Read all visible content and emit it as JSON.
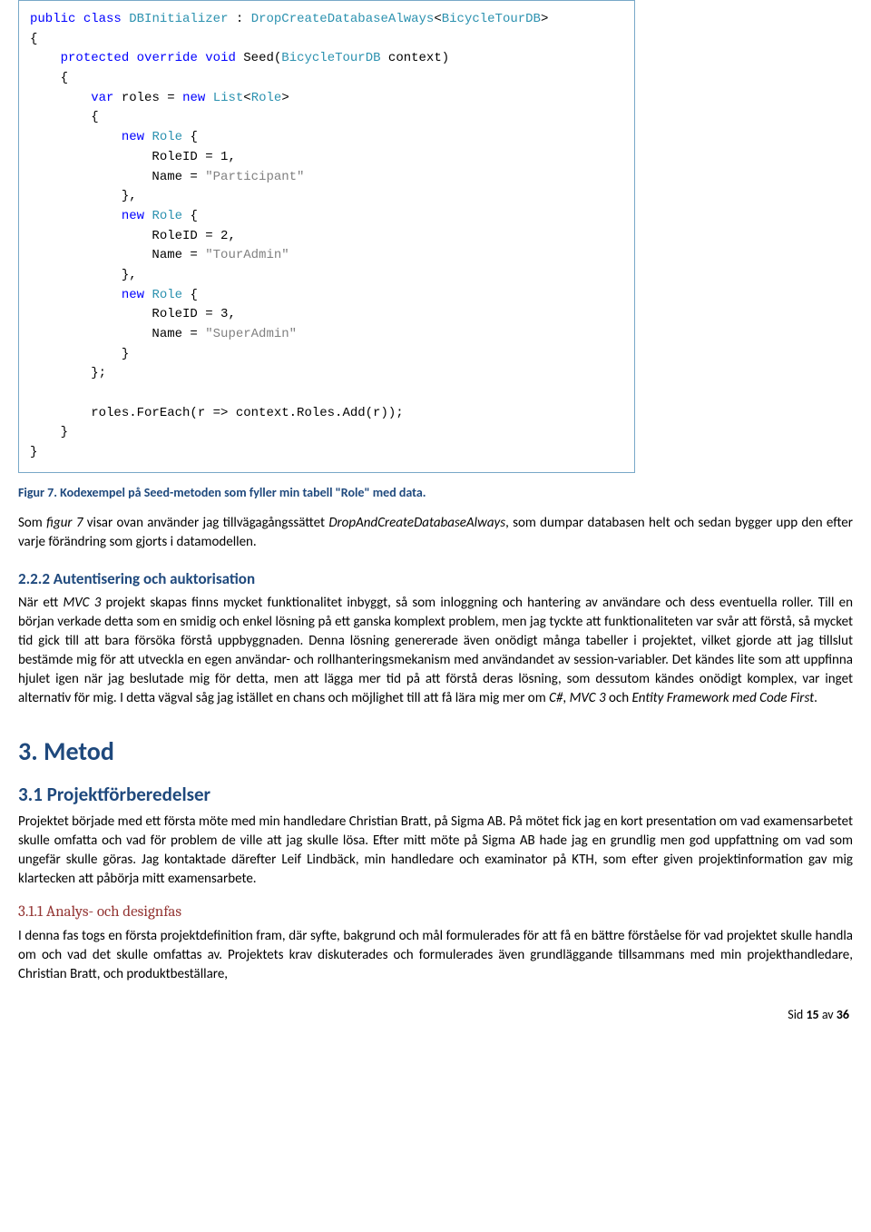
{
  "code": {
    "line1_kw1": "public",
    "line1_kw2": "class",
    "line1_type1": "DBInitializer",
    "line1_sep": " : ",
    "line1_type2": "DropCreateDatabaseAlways",
    "line1_lt": "<",
    "line1_type3": "BicycleTourDB",
    "line1_gt": ">",
    "line2": "{",
    "line3_kw1": "protected",
    "line3_kw2": "override",
    "line3_kw3": "void",
    "line3_name": " Seed(",
    "line3_type": "BicycleTourDB",
    "line3_rest": " context)",
    "line4": "    {",
    "line5_kw1": "var",
    "line5_txt1": " roles = ",
    "line5_kw2": "new",
    "line5_txt2": " ",
    "line5_type1": "List",
    "line5_lt": "<",
    "line5_type2": "Role",
    "line5_gt": ">",
    "line6": "        {",
    "line7_kw": "new",
    "line7_type": "Role",
    "line7_rest": " {",
    "line8_txt": "                RoleID = ",
    "line8_num": "1",
    "line8_comma": ",",
    "line9_txt": "                Name = ",
    "line9_str": "\"Participant\"",
    "line10": "            },",
    "line11_kw": "new",
    "line11_type": "Role",
    "line11_rest": " {",
    "line12_txt": "                RoleID = ",
    "line12_num": "2",
    "line12_comma": ",",
    "line13_txt": "                Name = ",
    "line13_str": "\"TourAdmin\"",
    "line14": "            },",
    "line15_kw": "new",
    "line15_type": "Role",
    "line15_rest": " {",
    "line16_txt": "                RoleID = ",
    "line16_num": "3",
    "line16_comma": ",",
    "line17_txt": "                Name = ",
    "line17_str": "\"SuperAdmin\"",
    "line18": "            }",
    "line19": "        };",
    "line20": "",
    "line21": "        roles.ForEach(r => context.Roles.Add(r));",
    "line22": "    }",
    "line23": "}"
  },
  "caption": "Figur 7. Kodexempel på Seed-metoden som fyller min tabell \"Role\" med data.",
  "para1_a": "Som ",
  "para1_b": "figur 7",
  "para1_c": " visar ovan använder jag tillvägagångssättet ",
  "para1_d": "DropAndCreateDatabaseAlways",
  "para1_e": ", som dumpar databasen helt och sedan bygger upp den efter varje förändring som gjorts i datamodellen.",
  "h4_1": "2.2.2 Autentisering och auktorisation",
  "para2_a": "När ett ",
  "para2_b": "MVC 3",
  "para2_c": " projekt skapas finns mycket funktionalitet inbyggt, så som inloggning och hantering av användare och dess eventuella roller. Till en början verkade detta som en smidig och enkel lösning på ett ganska komplext problem, men jag tyckte att funktionaliteten var svår att förstå, så mycket tid gick till att bara försöka förstå uppbyggnaden. Denna lösning genererade även onödigt många tabeller i projektet, vilket gjorde att jag tillslut bestämde mig för att utveckla en egen användar- och rollhanteringsmekanism med användandet av session-variabler. Det kändes lite som att uppfinna hjulet igen när jag beslutade mig för detta, men att lägga mer tid på att förstå deras lösning, som dessutom kändes onödigt komplex, var inget alternativ för mig. I detta vägval såg jag istället en chans och möjlighet till att få lära mig mer om ",
  "para2_d": "C#",
  "para2_e": ", ",
  "para2_f": "MVC 3",
  "para2_g": " och ",
  "para2_h": "Entity Framework med Code First",
  "para2_i": ".",
  "h2": "3. Metod",
  "h3": "3.1 Projektförberedelser",
  "para3": "Projektet började med ett första möte med min handledare Christian Bratt, på Sigma AB. På mötet fick jag en kort presentation om vad examensarbetet skulle omfatta och vad för problem de ville att jag skulle lösa. Efter mitt möte på Sigma AB hade jag en grundlig men god uppfattning om vad som ungefär skulle göras. Jag kontaktade därefter Leif Lindbäck, min handledare och examinator på KTH, som efter given projektinformation gav mig klartecken att påbörja mitt examensarbete.",
  "h4_2": "3.1.1 Analys- och designfas",
  "para4": "I denna fas togs en första projektdefinition fram, där syfte, bakgrund och mål formulerades för att få en bättre förståelse för vad projektet skulle handla om och vad det skulle omfattas av. Projektets krav diskuterades och formulerades även grundläggande tillsammans med min projekthandledare, Christian Bratt, och produktbeställare,",
  "footer_a": "Sid ",
  "footer_b": "15",
  "footer_c": " av ",
  "footer_d": "36"
}
